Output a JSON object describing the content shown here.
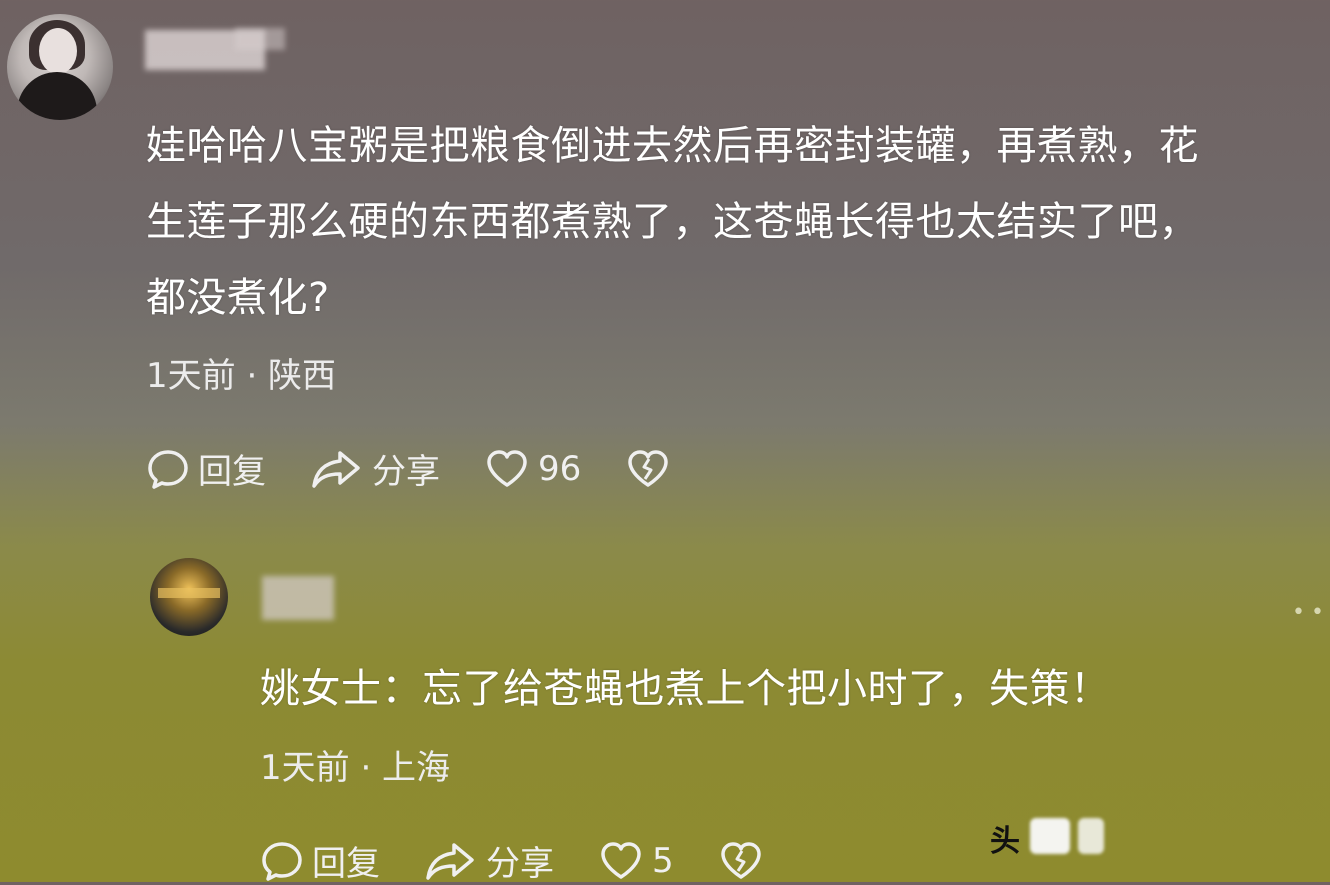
{
  "comments": [
    {
      "body_lines": [
        "娃哈哈八宝粥是把粮食倒进去然后再密封装罐，再煮熟，花",
        "生莲子那么硬的东西都煮熟了，这苍蝇长得也太结实了吧，",
        "都没煮化?"
      ],
      "meta": "1天前 · 陕西",
      "reply_label": "回复",
      "share_label": "分享",
      "like_count": "96"
    },
    {
      "body": "姚女士：忘了给苍蝇也煮上个把小时了，失策！",
      "meta": "1天前 · 上海",
      "reply_label": "回复",
      "share_label": "分享",
      "like_count": "5"
    }
  ],
  "watermark": "头",
  "icons": [
    "comment-icon",
    "share-icon",
    "heart-icon",
    "broken-heart-icon",
    "more-icon"
  ]
}
